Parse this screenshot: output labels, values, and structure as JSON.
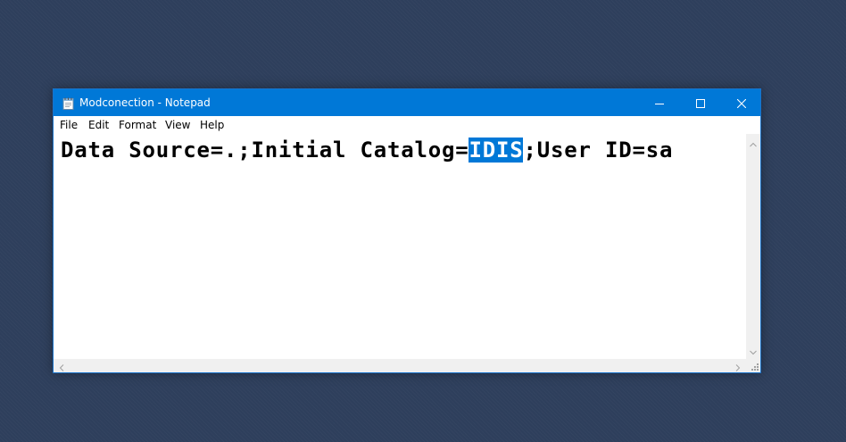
{
  "window": {
    "title": "Modconection - Notepad",
    "app_icon": "notepad-icon",
    "controls": {
      "minimize_icon": "minimize-icon",
      "maximize_icon": "maximize-icon",
      "close_icon": "close-icon"
    }
  },
  "menu": {
    "items": [
      {
        "label": "File"
      },
      {
        "label": "Edit"
      },
      {
        "label": "Format"
      },
      {
        "label": "View"
      },
      {
        "label": "Help"
      }
    ]
  },
  "editor": {
    "text_before": "Data Source=.;Initial Catalog=",
    "selected_text": "IDIS",
    "text_after": ";User ID=sa"
  },
  "colors": {
    "titlebar": "#0078d7",
    "selection": "#0078d7",
    "desktop": "#2e3f5c"
  }
}
